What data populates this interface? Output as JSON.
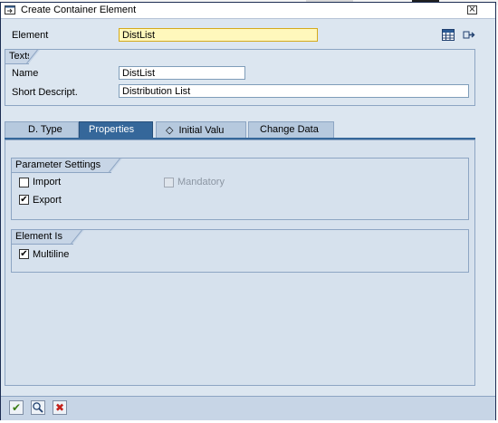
{
  "window": {
    "title": "Create Container Element",
    "close_glyph": "×"
  },
  "header": {
    "element_label": "Element",
    "element_value": "DistList"
  },
  "texts_group": {
    "title": "Texts",
    "name_label": "Name",
    "name_value": "DistList",
    "short_label": "Short Descript.",
    "short_value": "Distribution List"
  },
  "tabs": [
    {
      "label": "D. Type",
      "active": false
    },
    {
      "label": "Properties",
      "active": true
    },
    {
      "label": "Initial Valu",
      "active": false,
      "icon": "diamond-icon"
    },
    {
      "label": "Change Data",
      "active": false
    }
  ],
  "parameter_settings": {
    "title": "Parameter Settings",
    "import_label": "Import",
    "import_checked": false,
    "export_label": "Export",
    "export_checked": true,
    "mandatory_label": "Mandatory",
    "mandatory_checked": false,
    "mandatory_enabled": false
  },
  "element_is": {
    "title": "Element Is",
    "multiline_label": "Multiline",
    "multiline_checked": true
  },
  "toolbar_icons": [
    "grid-icon",
    "arrow-right-icon"
  ],
  "bottom_buttons": [
    "continue-button",
    "search-button",
    "cancel-button"
  ],
  "glyphs": {
    "check": "✔",
    "diamond": "◇",
    "cancel": "✖"
  },
  "colors": {
    "active_tab": "#35679a",
    "required_field": "#fff8bc",
    "panel_bg": "#dce6f0"
  }
}
